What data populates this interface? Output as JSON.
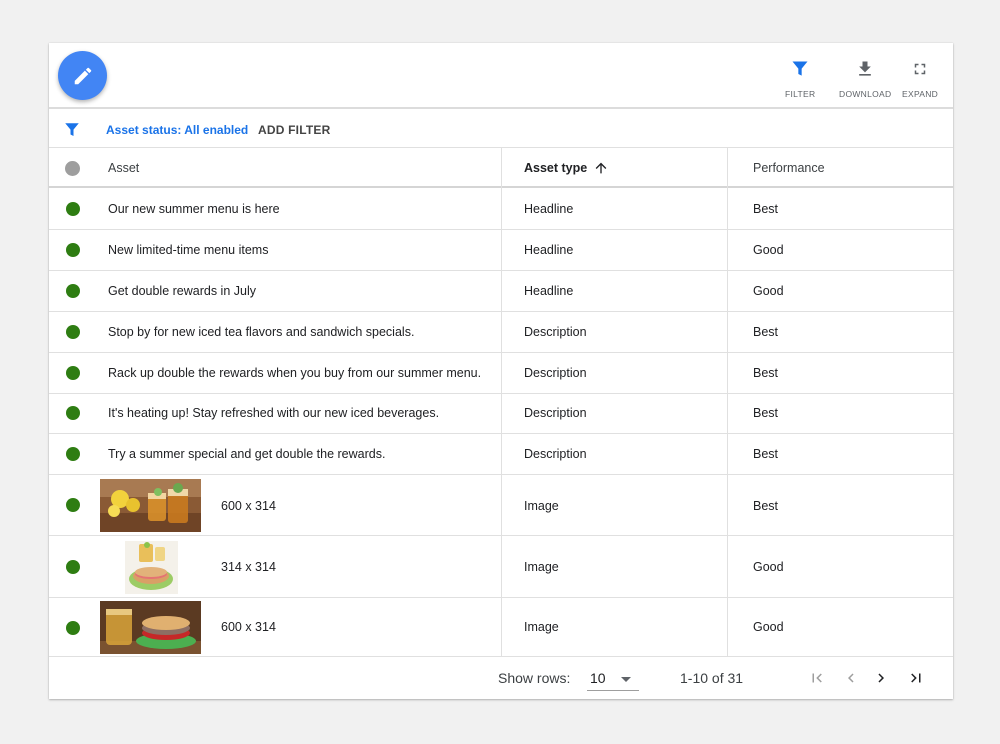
{
  "toolbar": {
    "edit_icon": "pencil-icon",
    "buttons": [
      {
        "label": "FILTER",
        "icon": "filter-icon",
        "color": "#1a73e8"
      },
      {
        "label": "DOWNLOAD",
        "icon": "download-icon",
        "color": "#5f6368"
      },
      {
        "label": "EXPAND",
        "icon": "fullscreen-icon",
        "color": "#5f6368"
      }
    ]
  },
  "filterbar": {
    "icon": "filter-icon",
    "active_filter": "Asset status: All enabled",
    "add_filter": "ADD FILTER"
  },
  "table": {
    "columns": {
      "asset": "Asset",
      "asset_type": "Asset type",
      "performance": "Performance"
    },
    "sort": {
      "column": "asset_type",
      "direction": "ascending"
    },
    "status_colors": {
      "enabled": "#2e7d12",
      "header": "#9e9e9e"
    },
    "rows": [
      {
        "asset": "Our new summer menu is here",
        "type": "Headline",
        "performance": "Best"
      },
      {
        "asset": "New limited-time menu items",
        "type": "Headline",
        "performance": "Good"
      },
      {
        "asset": "Get double rewards in July",
        "type": "Headline",
        "performance": "Good"
      },
      {
        "asset": "Stop by for new iced tea flavors and sandwich specials.",
        "type": "Description",
        "performance": "Best"
      },
      {
        "asset": "Rack up double the rewards when you buy from our summer menu.",
        "type": "Description",
        "performance": "Best"
      },
      {
        "asset": "It's heating up! Stay refreshed with our new iced beverages.",
        "type": "Description",
        "performance": "Best"
      },
      {
        "asset": "Try a summer special and get double the rewards.",
        "type": "Description",
        "performance": "Best"
      },
      {
        "asset": "600 x 314",
        "type": "Image",
        "performance": "Best",
        "thumb": "iced-tea-lemons-image"
      },
      {
        "asset": "314 x 314",
        "type": "Image",
        "performance": "Good",
        "thumb": "sandwich-tea-square-image"
      },
      {
        "asset": "600 x 314",
        "type": "Image",
        "performance": "Good",
        "thumb": "sandwich-jar-image"
      }
    ]
  },
  "footer": {
    "show_rows_label": "Show rows:",
    "rows_per_page": "10",
    "range": "1-10 of 31"
  }
}
